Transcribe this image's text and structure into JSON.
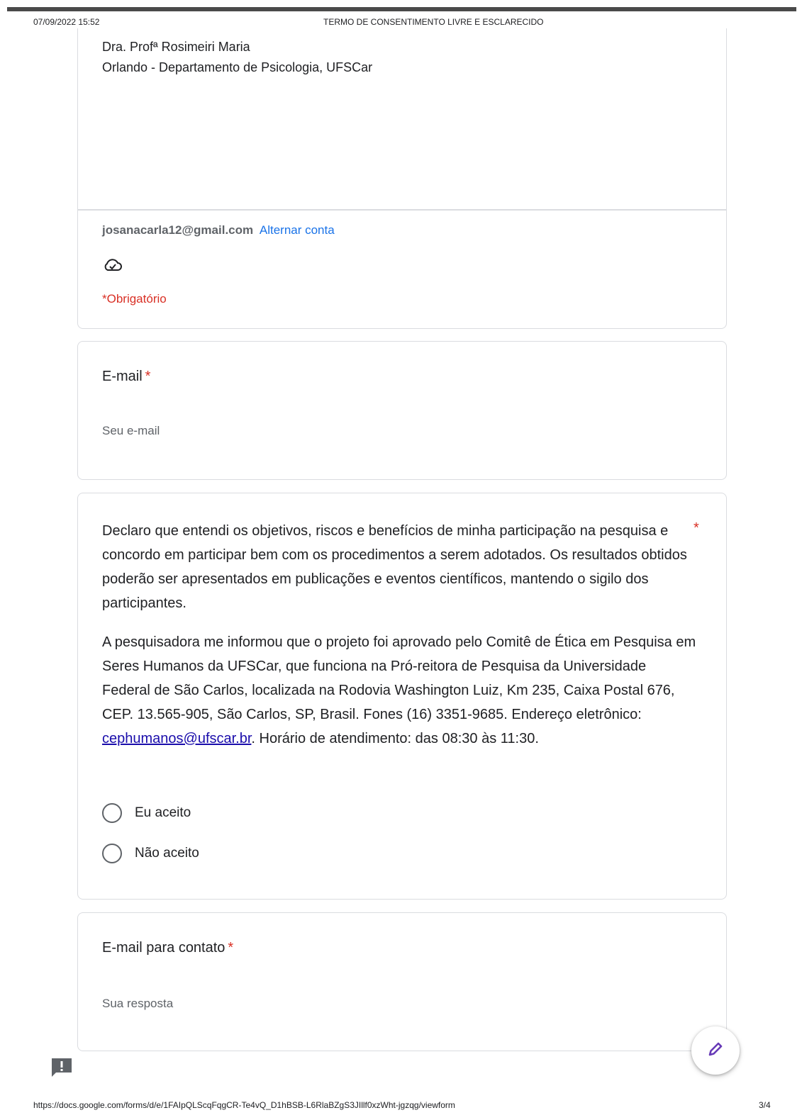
{
  "print_header": {
    "date": "07/09/2022 15:52",
    "title": "TERMO DE CONSENTIMENTO LIVRE E ESCLARECIDO"
  },
  "intro": {
    "researcher_line1": "Dra. Profª Rosimeiri Maria",
    "researcher_line2": "Orlando - Departamento de Psicologia, UFSCar",
    "account_email": "josanacarla12@gmail.com",
    "switch_account": "Alternar conta",
    "required_note": "*Obrigatório",
    "cloud_icon": "cloud-check-icon"
  },
  "email_question": {
    "title": "E-mail",
    "required_mark": "*",
    "placeholder": "Seu e-mail"
  },
  "consent_question": {
    "paragraph1": "Declaro que entendi os objetivos, riscos e benefícios de minha participação na pesquisa e concordo em participar bem com os procedimentos a serem adotados. Os resultados obtidos poderão ser apresentados em publicações e eventos científicos, mantendo o sigilo dos participantes.",
    "required_mark": "*",
    "paragraph2_before": "A pesquisadora me informou que o projeto foi aprovado pelo Comitê de Ética em Pesquisa em Seres Humanos da UFSCar, que funciona na Pró-reitora de Pesquisa da Universidade Federal de São Carlos, localizada na Rodovia Washington Luiz, Km 235, Caixa Postal 676, CEP. 13.565-905, São Carlos, SP, Brasil. Fones (16) 3351-9685. Endereço eletrônico: ",
    "paragraph2_link": "cephumanos@ufscar.br",
    "paragraph2_after": ". Horário de atendimento: das 08:30 às 11:30.",
    "options": [
      "Eu aceito",
      "Não aceito"
    ]
  },
  "contact_question": {
    "title": "E-mail para contato",
    "required_mark": "*",
    "placeholder": "Sua resposta"
  },
  "footer": {
    "url": "https://docs.google.com/forms/d/e/1FAIpQLScqFqgCR-Te4vQ_D1hBSB-L6RlaBZgS3JIllf0xzWht-jgzqg/viewform",
    "page": "3/4"
  },
  "icons": {
    "edit": "pencil-icon",
    "feedback": "feedback-icon"
  },
  "colors": {
    "required": "#d93025",
    "link": "#1a73e8",
    "fab_icon": "#673ab7"
  }
}
